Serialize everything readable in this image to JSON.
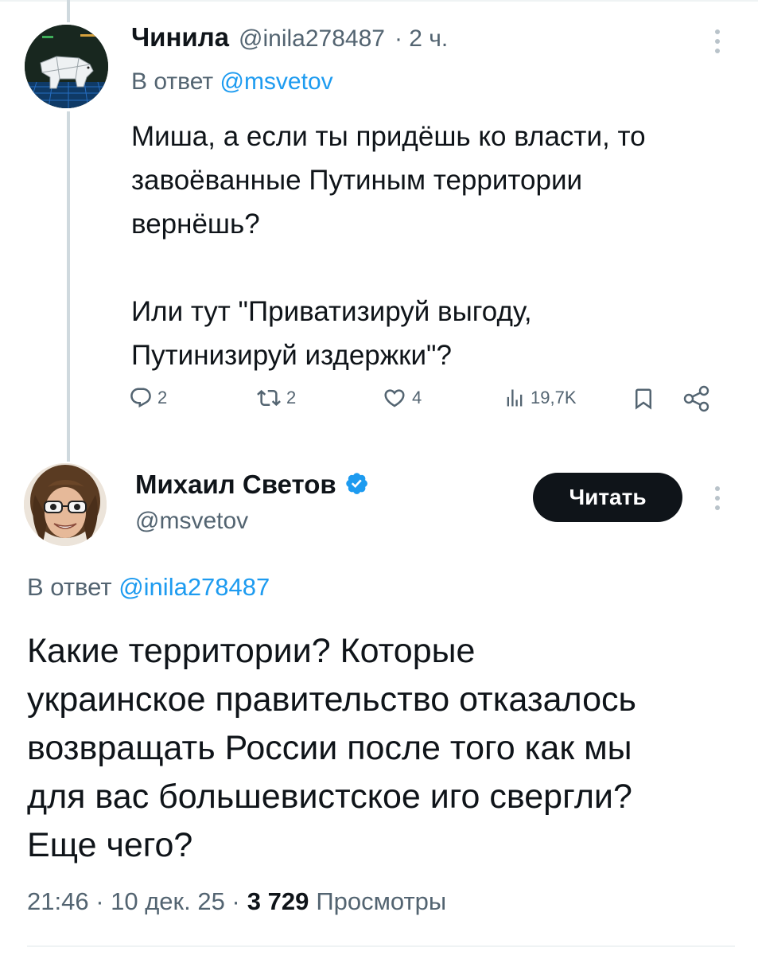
{
  "reply_tweet": {
    "author_name": "Чинила",
    "author_handle": "@inila278487",
    "time": "· 2 ч.",
    "reply_prefix": "В ответ",
    "reply_to": "@msvetov",
    "text": "Миша, а если ты придёшь ко власти, то\nзавоёванные Путиным территории\nвернёшь?\n\nИли тут \"Приватизируй выгоду,\nПутинизируй издержки\"?",
    "actions": {
      "replies": "2",
      "retweets": "2",
      "likes": "4",
      "views": "19,7K"
    },
    "icons": [
      "avatar-polar-bear",
      "more-icon",
      "reply-icon",
      "retweet-icon",
      "like-icon",
      "views-icon",
      "bookmark-icon",
      "share-icon"
    ]
  },
  "main_tweet": {
    "author_name": "Михаил Светов",
    "author_handle": "@msvetov",
    "follow_label": "Читать",
    "reply_prefix": "В ответ",
    "reply_to": "@inila278487",
    "text_lines": [
      "Какие территории? Которые",
      "украинское правительство отказалось",
      "возвращать России после того как мы",
      "для вас большевистское иго свергли?",
      "Еще чего?"
    ],
    "time": "21:46 · 10 дек. 25 ·",
    "views_count": "3 729",
    "views_label": "Просмотры",
    "icons": [
      "verified-badge-icon",
      "more-icon"
    ]
  },
  "colors": {
    "accent": "#1d9bf0",
    "muted": "#536471",
    "text": "#0f1419"
  }
}
